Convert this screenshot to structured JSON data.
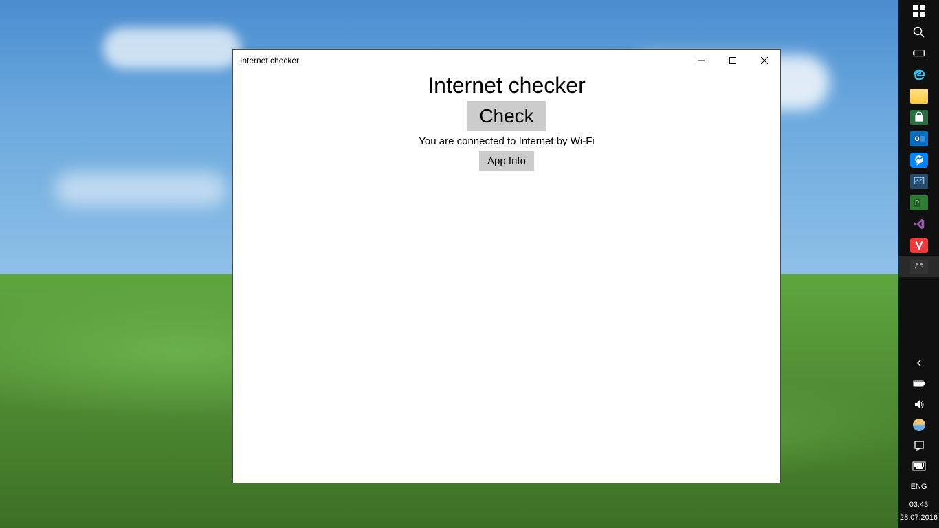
{
  "window": {
    "title": "Internet checker"
  },
  "app": {
    "heading": "Internet checker",
    "check_button": "Check",
    "status_text": "You are connected to Internet by Wi-Fi",
    "appinfo_button": "App Info"
  },
  "taskbar": {
    "systray": {
      "language": "ENG",
      "time": "03:43",
      "date": "28.07.2016"
    }
  }
}
